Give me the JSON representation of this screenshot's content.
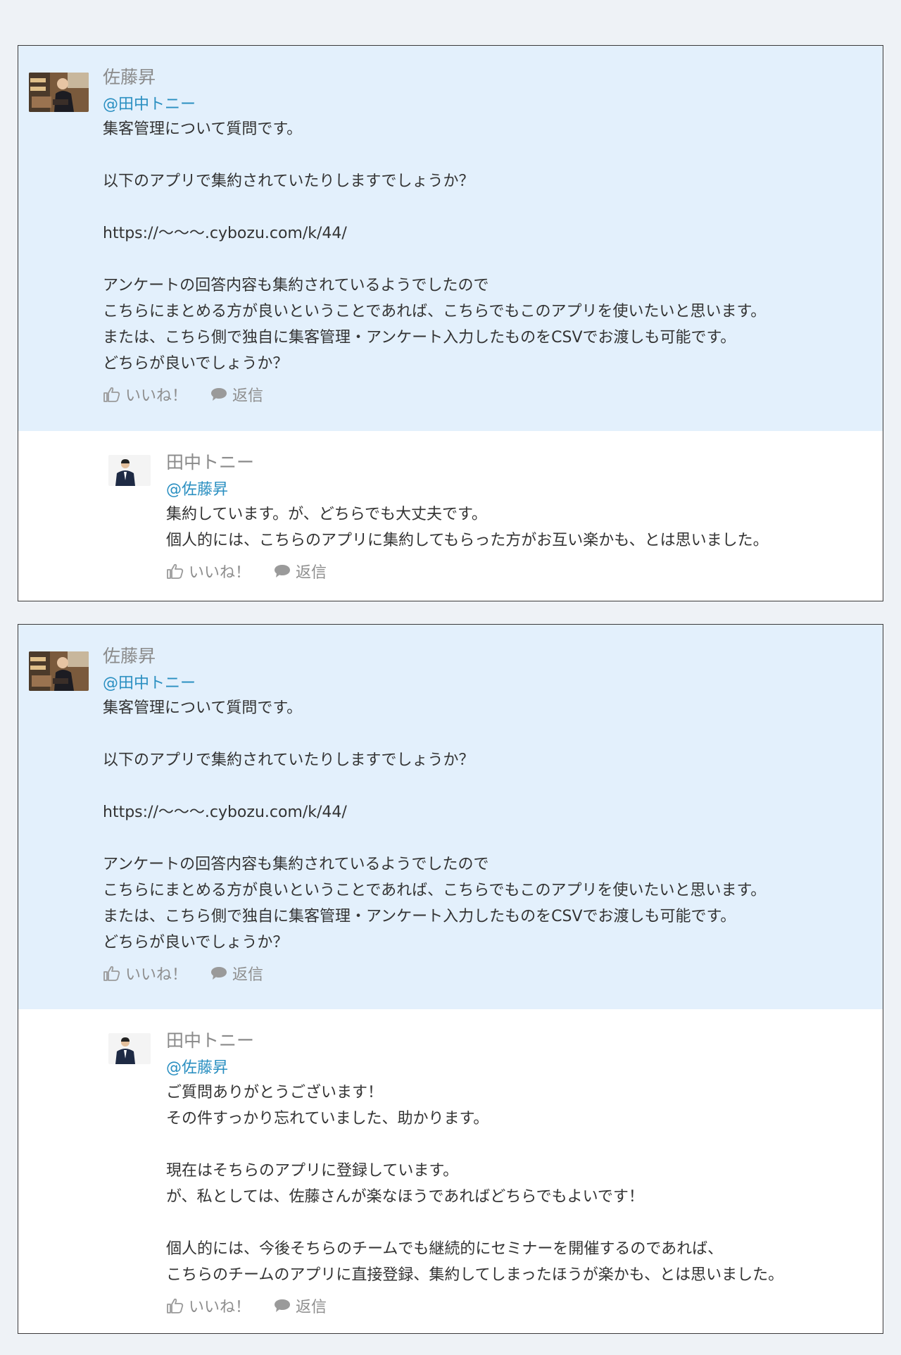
{
  "threads": [
    {
      "post": {
        "author": "佐藤昇",
        "mention": "@田中トニー",
        "text": "集客管理について質問です。\n\n以下のアプリで集約されていたりしますでしょうか？\n\nhttps://〜〜〜.cybozu.com/k/44/\n\nアンケートの回答内容も集約されているようでしたので\nこちらにまとめる方が良いということであれば、こちらでもこのアプリを使いたいと思います。\nまたは、こちら側で独自に集客管理・アンケート入力したものをCSVでお渡しも可能です。\nどちらが良いでしょうか？",
        "like_label": "いいね！",
        "reply_label": "返信"
      },
      "reply": {
        "author": "田中トニー",
        "mention": "@佐藤昇",
        "text": "集約しています。が、どちらでも大丈夫です。\n個人的には、こちらのアプリに集約してもらった方がお互い楽かも、とは思いました。",
        "like_label": "いいね！",
        "reply_label": "返信"
      }
    },
    {
      "post": {
        "author": "佐藤昇",
        "mention": "@田中トニー",
        "text": "集客管理について質問です。\n\n以下のアプリで集約されていたりしますでしょうか？\n\nhttps://〜〜〜.cybozu.com/k/44/\n\nアンケートの回答内容も集約されているようでしたので\nこちらにまとめる方が良いということであれば、こちらでもこのアプリを使いたいと思います。\nまたは、こちら側で独自に集客管理・アンケート入力したものをCSVでお渡しも可能です。\nどちらが良いでしょうか？",
        "like_label": "いいね！",
        "reply_label": "返信"
      },
      "reply": {
        "author": "田中トニー",
        "mention": "@佐藤昇",
        "text": "ご質問ありがとうございます！\nその件すっかり忘れていました、助かります。\n\n現在はそちらのアプリに登録しています。\nが、私としては、佐藤さんが楽なほうであればどちらでもよいです！\n\n個人的には、今後そちらのチームでも継続的にセミナーを開催するのであれば、\nこちらのチームのアプリに直接登録、集約してしまったほうが楽かも、とは思いました。",
        "like_label": "いいね！",
        "reply_label": "返信"
      }
    }
  ],
  "colors": {
    "post_background": "#e3f0fc",
    "mention": "#2a8fc1",
    "author": "#8a8a8a",
    "action": "#8e8e8e"
  },
  "icons": [
    "thumbs-up-icon",
    "speech-bubble-icon"
  ]
}
